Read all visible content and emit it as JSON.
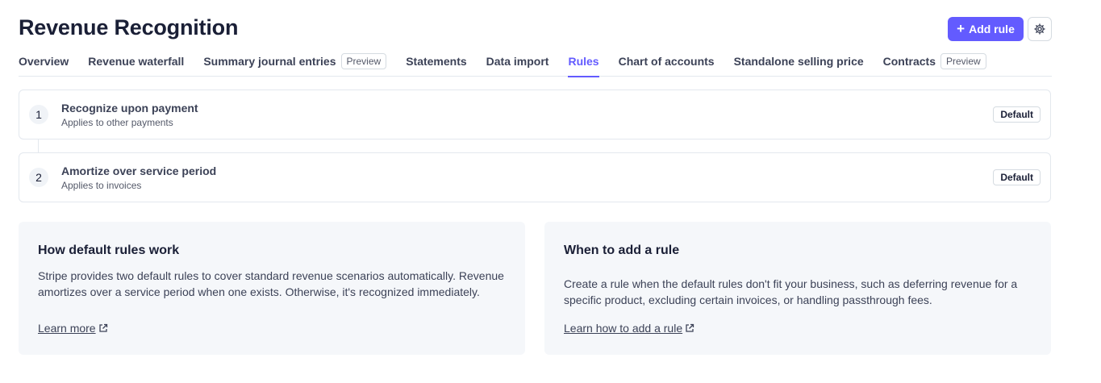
{
  "page": {
    "title": "Revenue Recognition"
  },
  "header": {
    "add_rule_label": "Add rule"
  },
  "tabs": [
    {
      "label": "Overview"
    },
    {
      "label": "Revenue waterfall"
    },
    {
      "label": "Summary journal entries",
      "badge": "Preview"
    },
    {
      "label": "Statements"
    },
    {
      "label": "Data import"
    },
    {
      "label": "Rules",
      "active": true
    },
    {
      "label": "Chart of accounts"
    },
    {
      "label": "Standalone selling price"
    },
    {
      "label": "Contracts",
      "badge": "Preview"
    }
  ],
  "rules": [
    {
      "number": "1",
      "title": "Recognize upon payment",
      "subtitle": "Applies to other payments",
      "badge": "Default"
    },
    {
      "number": "2",
      "title": "Amortize over service period",
      "subtitle": "Applies to invoices",
      "badge": "Default"
    }
  ],
  "info_cards": [
    {
      "title": "How default rules work",
      "body": "Stripe provides two default rules to cover standard revenue scenarios automatically. Revenue amortizes over a service period when one exists. Otherwise, it's recognized immediately.",
      "link": "Learn more"
    },
    {
      "title": "When to add a rule",
      "body": "Create a rule when the default rules don't fit your business, such as deferring revenue for a specific product, excluding certain invoices, or handling passthrough fees.",
      "link": "Learn how to add a rule"
    }
  ],
  "colors": {
    "accent": "#635bff",
    "text": "#1a1f36",
    "muted": "#545969",
    "card_bg": "#f5f7fa",
    "border": "#e3e8ee"
  },
  "icons": {
    "add": "plus-icon",
    "settings": "gear-icon",
    "external": "external-link-icon"
  }
}
